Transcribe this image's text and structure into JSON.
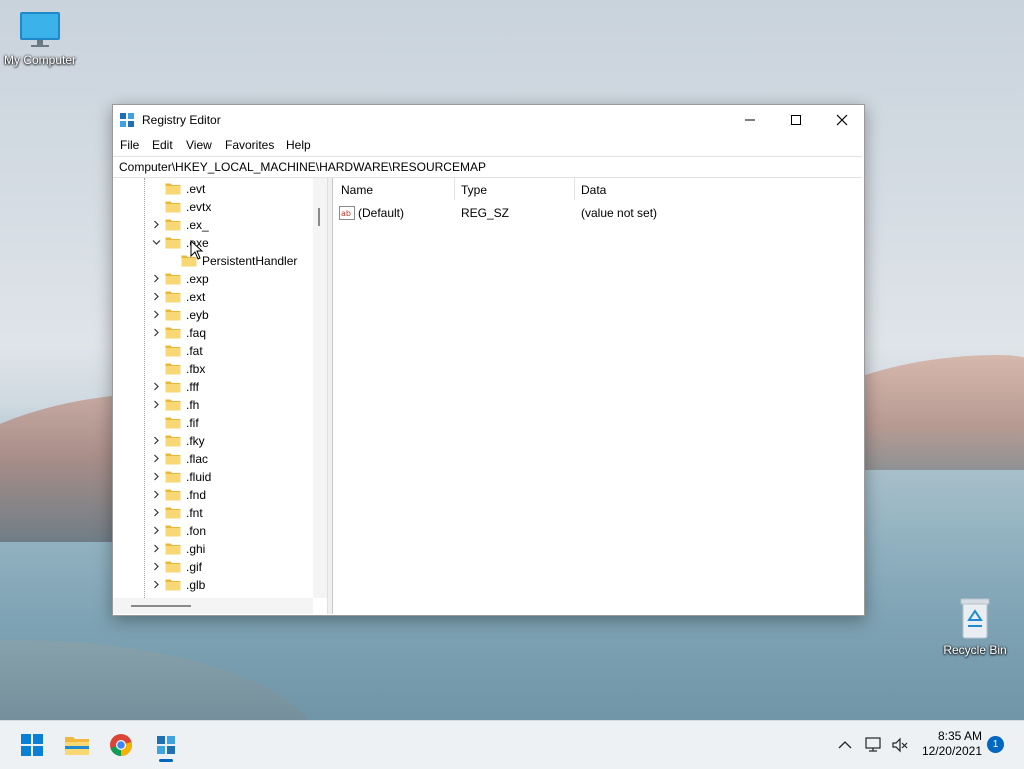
{
  "desktop": {
    "my_computer_label": "My Computer",
    "recycle_bin_label": "Recycle Bin"
  },
  "window": {
    "title": "Registry Editor",
    "menu": [
      "File",
      "Edit",
      "View",
      "Favorites",
      "Help"
    ],
    "address": "Computer\\HKEY_LOCAL_MACHINE\\HARDWARE\\RESOURCEMAP",
    "tree": [
      {
        "label": ".evt",
        "indent": 0,
        "chevron": "none"
      },
      {
        "label": ".evtx",
        "indent": 0,
        "chevron": "none"
      },
      {
        "label": ".ex_",
        "indent": 0,
        "chevron": "right"
      },
      {
        "label": ".exe",
        "indent": 0,
        "chevron": "down"
      },
      {
        "label": "PersistentHandler",
        "indent": 1,
        "chevron": "none"
      },
      {
        "label": ".exp",
        "indent": 0,
        "chevron": "right"
      },
      {
        "label": ".ext",
        "indent": 0,
        "chevron": "right"
      },
      {
        "label": ".eyb",
        "indent": 0,
        "chevron": "right"
      },
      {
        "label": ".faq",
        "indent": 0,
        "chevron": "right"
      },
      {
        "label": ".fat",
        "indent": 0,
        "chevron": "none"
      },
      {
        "label": ".fbx",
        "indent": 0,
        "chevron": "none"
      },
      {
        "label": ".fff",
        "indent": 0,
        "chevron": "right"
      },
      {
        "label": ".fh",
        "indent": 0,
        "chevron": "right"
      },
      {
        "label": ".fif",
        "indent": 0,
        "chevron": "none"
      },
      {
        "label": ".fky",
        "indent": 0,
        "chevron": "right"
      },
      {
        "label": ".flac",
        "indent": 0,
        "chevron": "right"
      },
      {
        "label": ".fluid",
        "indent": 0,
        "chevron": "right"
      },
      {
        "label": ".fnd",
        "indent": 0,
        "chevron": "right"
      },
      {
        "label": ".fnt",
        "indent": 0,
        "chevron": "right"
      },
      {
        "label": ".fon",
        "indent": 0,
        "chevron": "right"
      },
      {
        "label": ".ghi",
        "indent": 0,
        "chevron": "right"
      },
      {
        "label": ".gif",
        "indent": 0,
        "chevron": "right"
      },
      {
        "label": ".glb",
        "indent": 0,
        "chevron": "right"
      }
    ],
    "columns": {
      "name": "Name",
      "type": "Type",
      "data": "Data"
    },
    "values": [
      {
        "name": "(Default)",
        "type": "REG_SZ",
        "data": "(value not set)"
      }
    ]
  },
  "taskbar": {
    "time": "8:35 AM",
    "date": "12/20/2021",
    "notification_count": "1"
  },
  "colors": {
    "accent": "#0067c0",
    "folder": "#f8d775"
  }
}
